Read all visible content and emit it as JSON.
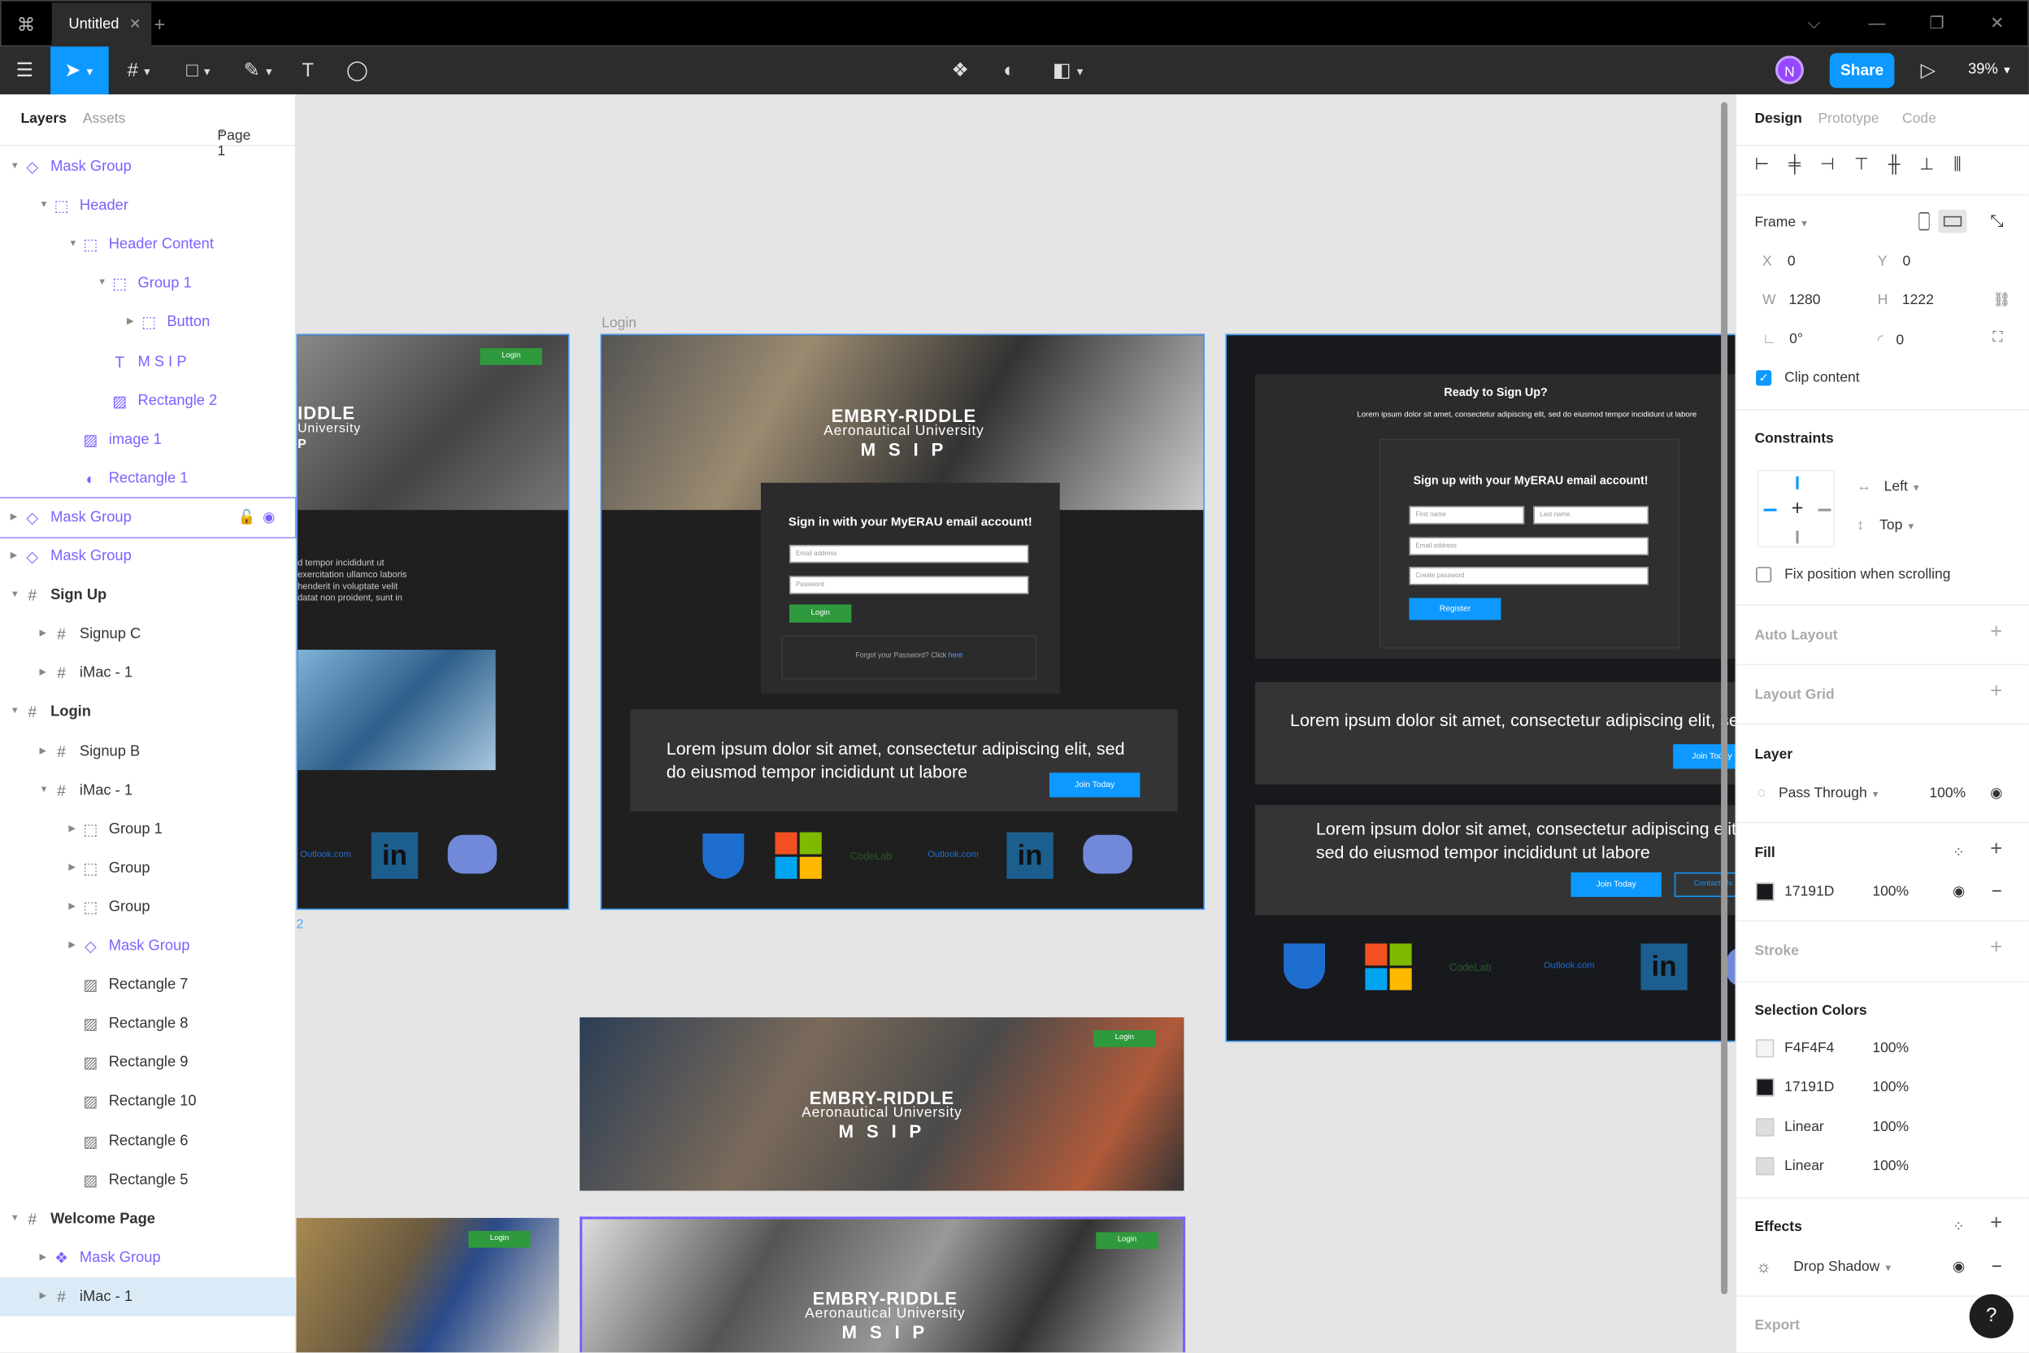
{
  "titlebar": {
    "tab_title": "Untitled",
    "tab_close": "✕",
    "new_tab": "+",
    "minimize": "—",
    "restore": "❐",
    "close": "✕",
    "dropdown": "⌵"
  },
  "toolbar": {
    "avatar_initial": "N",
    "share_label": "Share",
    "zoom_label": "39%"
  },
  "left_panel": {
    "tabs": {
      "layers": "Layers",
      "assets": "Assets",
      "page": "Page 1"
    },
    "layers": [
      {
        "name": "Mask Group",
        "icon": "mask-icon",
        "depth": 0,
        "expanded": true,
        "purple": true
      },
      {
        "name": "Header",
        "icon": "group-icon",
        "depth": 1,
        "expanded": true,
        "purple": true
      },
      {
        "name": "Header Content",
        "icon": "group-icon",
        "depth": 2,
        "expanded": true,
        "purple": true
      },
      {
        "name": "Group 1",
        "icon": "group-icon",
        "depth": 3,
        "expanded": true,
        "purple": true
      },
      {
        "name": "Button",
        "icon": "group-icon",
        "depth": 4,
        "expanded": false,
        "purple": true
      },
      {
        "name": "M S I P",
        "icon": "text-icon",
        "depth": 3,
        "purple": true
      },
      {
        "name": "Rectangle 2",
        "icon": "image-icon",
        "depth": 3,
        "purple": true
      },
      {
        "name": "image 1",
        "icon": "image-icon",
        "depth": 2,
        "purple": true
      },
      {
        "name": "Rectangle 1",
        "icon": "ellipse-icon",
        "depth": 2,
        "purple": true
      },
      {
        "name": "Mask Group",
        "icon": "mask-icon",
        "depth": 0,
        "expanded": false,
        "purple": true,
        "hover": true
      },
      {
        "name": "Mask Group",
        "icon": "mask-icon",
        "depth": 0,
        "expanded": false,
        "purple": true
      },
      {
        "name": "Sign Up",
        "icon": "frame-icon",
        "depth": 0,
        "expanded": true,
        "bold": true
      },
      {
        "name": "Signup C",
        "icon": "frame-icon",
        "depth": 1,
        "expanded": false
      },
      {
        "name": "iMac - 1",
        "icon": "frame-icon",
        "depth": 1,
        "expanded": false
      },
      {
        "name": "Login",
        "icon": "frame-icon",
        "depth": 0,
        "expanded": true,
        "bold": true
      },
      {
        "name": "Signup B",
        "icon": "frame-icon",
        "depth": 1,
        "expanded": false
      },
      {
        "name": "iMac - 1",
        "icon": "frame-icon",
        "depth": 1,
        "expanded": true
      },
      {
        "name": "Group 1",
        "icon": "group-icon",
        "depth": 2,
        "expanded": false
      },
      {
        "name": "Group",
        "icon": "group-icon",
        "depth": 2,
        "expanded": false
      },
      {
        "name": "Group",
        "icon": "group-icon",
        "depth": 2,
        "expanded": false
      },
      {
        "name": "Mask Group",
        "icon": "mask-icon",
        "depth": 2,
        "expanded": false,
        "purple": true
      },
      {
        "name": "Rectangle 7",
        "icon": "image-icon",
        "depth": 2
      },
      {
        "name": "Rectangle 8",
        "icon": "image-icon",
        "depth": 2
      },
      {
        "name": "Rectangle 9",
        "icon": "image-icon",
        "depth": 2
      },
      {
        "name": "Rectangle 10",
        "icon": "image-icon",
        "depth": 2
      },
      {
        "name": "Rectangle 6",
        "icon": "image-icon",
        "depth": 2
      },
      {
        "name": "Rectangle 5",
        "icon": "image-icon",
        "depth": 2
      },
      {
        "name": "Welcome Page",
        "icon": "frame-icon",
        "depth": 0,
        "expanded": true,
        "bold": true
      },
      {
        "name": "Mask Group",
        "icon": "component-icon",
        "depth": 1,
        "expanded": false,
        "purple": true
      },
      {
        "name": "iMac - 1",
        "icon": "frame-icon",
        "depth": 1,
        "expanded": false,
        "selected": true
      }
    ]
  },
  "canvas": {
    "frame_label": "Login",
    "frame_number": "2",
    "outlook": "Outlook.com",
    "codelab": "CodeLab",
    "login_btn": "Login",
    "brand_line1": "EMBRY-RIDDLE",
    "brand_line2": "Aeronautical University",
    "brand_line3": "M S I P",
    "brand_partial1": "IDDLE",
    "brand_partial2": "University",
    "brand_partial3": "P",
    "left_lorem": "d tempor incididunt ut\nexercitation ullamco laboris\nhenderit in voluptate velit\ndatat non proident, sunt in",
    "signin_title": "Sign in with your MyERAU email account!",
    "email_placeholder": "Email address",
    "password_placeholder": "Password",
    "forgot_text": "Forgot your Password? Click",
    "forgot_link": "here",
    "lorem_main": "Lorem ipsum dolor sit amet, consectetur adipiscing elit, sed do eiusmod tempor incididunt ut labore",
    "join_today": "Join Today",
    "contact_us": "Contact Us",
    "ready_title": "Ready to Sign Up?",
    "ready_sub": "Lorem ipsum dolor sit amet, consectetur adipiscing elit, sed do eiusmod tempor incididunt ut labore",
    "signup_title": "Sign up with your MyERAU email account!",
    "first_name": "First name",
    "last_name": "Last name",
    "create_password": "Create password",
    "register": "Register",
    "lorem_r1": "Lorem ipsum dolor sit amet, consectetur adipiscing elit, sed do eiusmod tempor incididunt ut labore",
    "lorem_r2": "Lorem ipsum dolor sit amet, consectetur adipiscing elit, sed do eiusmod tempor incididunt ut labore"
  },
  "right_panel": {
    "tabs": {
      "design": "Design",
      "prototype": "Prototype",
      "code": "Code"
    },
    "frame_label": "Frame",
    "x_label": "X",
    "x_value": "0",
    "y_label": "Y",
    "y_value": "0",
    "w_label": "W",
    "w_value": "1280",
    "h_label": "H",
    "h_value": "1222",
    "rotation": "0°",
    "radius": "0",
    "clip_content": "Clip content",
    "constraints_title": "Constraints",
    "constraint_h": "Left",
    "constraint_v": "Top",
    "fix_position": "Fix position when scrolling",
    "auto_layout": "Auto Layout",
    "layout_grid": "Layout Grid",
    "layer_title": "Layer",
    "blend_mode": "Pass Through",
    "layer_opacity": "100%",
    "fill_title": "Fill",
    "fill_hex": "17191D",
    "fill_opacity": "100%",
    "stroke_title": "Stroke",
    "selection_colors_title": "Selection Colors",
    "selection_colors": [
      {
        "label": "F4F4F4",
        "opacity": "100%",
        "color": "#F4F4F4"
      },
      {
        "label": "17191D",
        "opacity": "100%",
        "color": "#17191D"
      },
      {
        "label": "Linear",
        "opacity": "100%",
        "color": "#dddddd"
      },
      {
        "label": "Linear",
        "opacity": "100%",
        "color": "#dddddd"
      }
    ],
    "effects_title": "Effects",
    "effect_name": "Drop Shadow",
    "export_title": "Export",
    "help": "?"
  },
  "colors": {
    "accent": "#0d99ff",
    "purple": "#7b61ff",
    "login_green": "#2e9a3d",
    "frame_dark": "#17191D"
  }
}
